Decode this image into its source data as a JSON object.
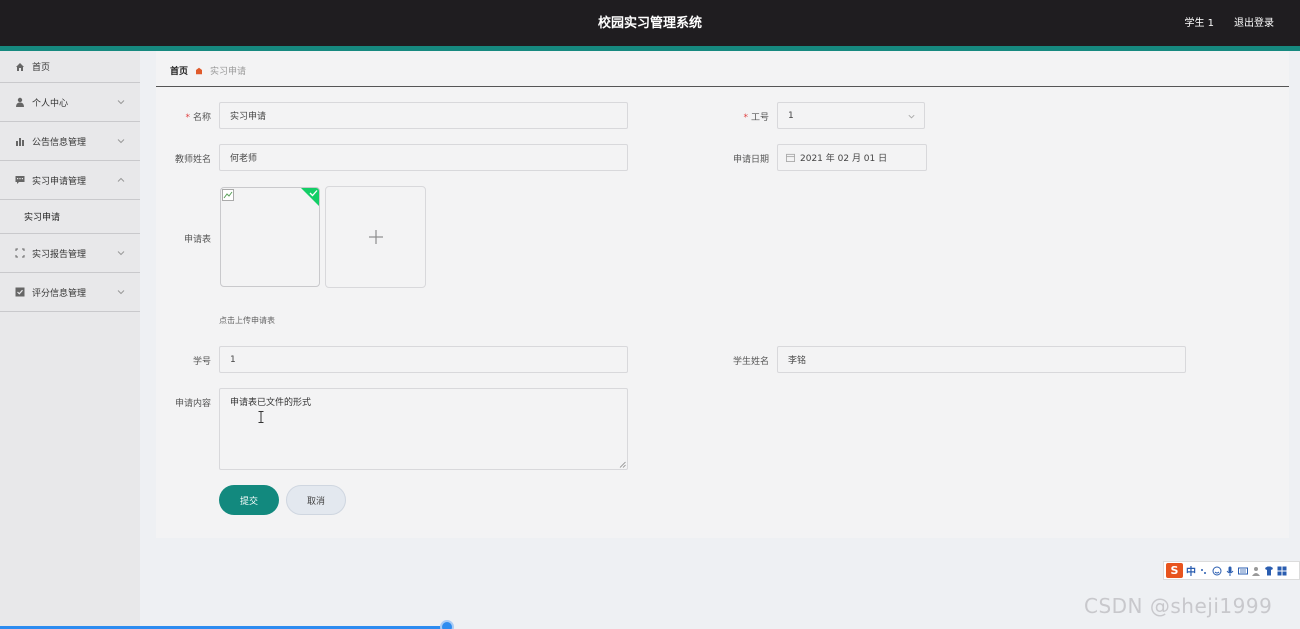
{
  "header": {
    "title": "校园实习管理系统",
    "user": "学生 1",
    "logout": "退出登录"
  },
  "sidebar": {
    "items": [
      {
        "label": "首页",
        "icon": "home-icon"
      },
      {
        "label": "个人中心",
        "icon": "user-icon"
      },
      {
        "label": "公告信息管理",
        "icon": "bar-chart-icon"
      },
      {
        "label": "实习申请管理",
        "icon": "chat-icon",
        "expanded": true
      },
      {
        "label": "实习报告管理",
        "icon": "fullscreen-icon"
      },
      {
        "label": "评分信息管理",
        "icon": "checkbox-icon"
      }
    ],
    "sub_items": [
      {
        "label": "实习申请"
      }
    ]
  },
  "breadcrumb": {
    "home": "首页",
    "current": "实习申请"
  },
  "form": {
    "name_label": "名称",
    "name_value": "实习申请",
    "worker_id_label": "工号",
    "worker_id_value": "1",
    "teacher_label": "教师姓名",
    "teacher_value": "何老师",
    "date_label": "申请日期",
    "date_value": "2021 年 02 月 01 日",
    "form_label": "申请表",
    "upload_hint": "点击上传申请表",
    "student_id_label": "学号",
    "student_id_value": "1",
    "student_name_label": "学生姓名",
    "student_name_value": "李铭",
    "content_label": "申请内容",
    "content_value": "申请表已文件的形式",
    "submit": "提交",
    "cancel": "取消"
  },
  "ime": {
    "mode": "中"
  },
  "watermark": "CSDN @sheji1999",
  "colors": {
    "accent": "#12897e",
    "header_bg": "#1f1d20",
    "required": "#e04040",
    "success": "#13ce66"
  }
}
